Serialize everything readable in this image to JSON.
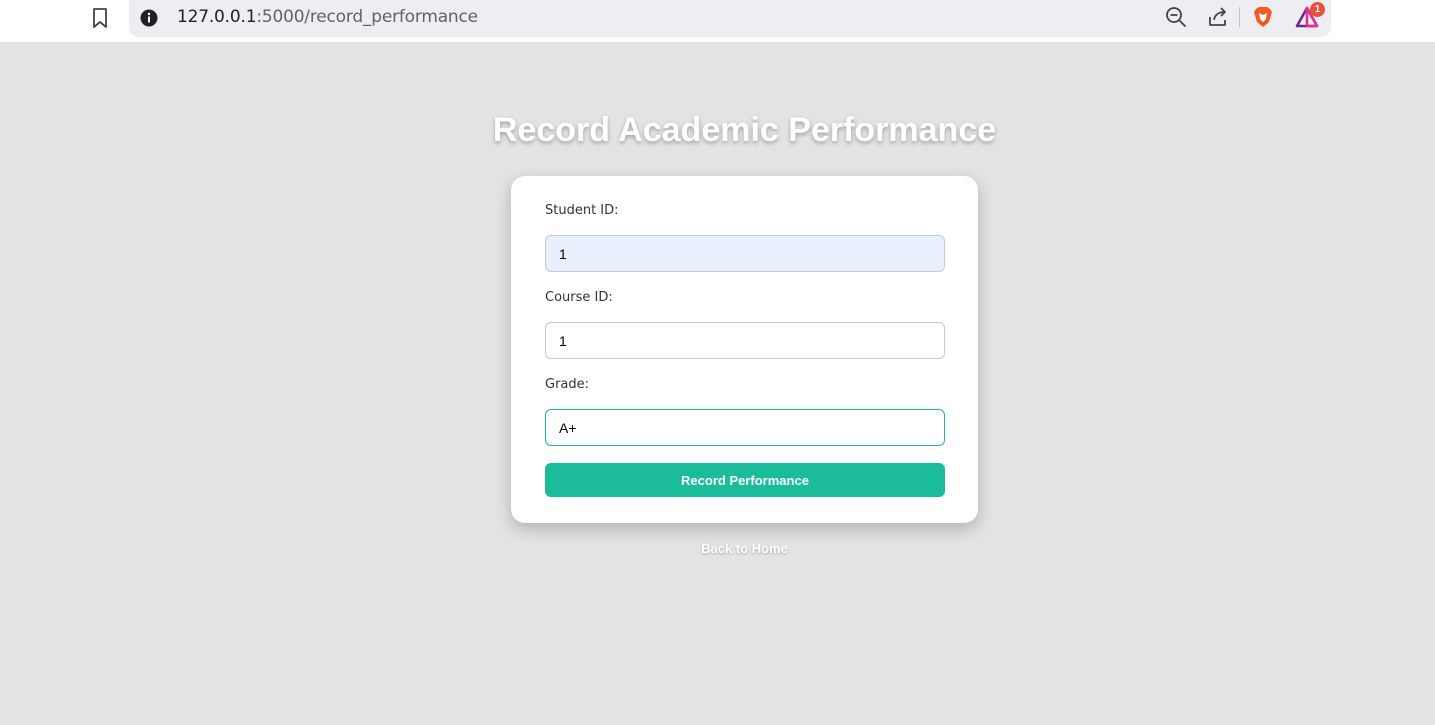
{
  "browser": {
    "url_host": "127.0.0.1",
    "url_rest": ":5000/record_performance",
    "rewards_badge_count": "1",
    "icons": [
      "bookmark-icon",
      "site-info-icon",
      "zoom-icon",
      "share-icon",
      "brave-icon",
      "rewards-icon"
    ]
  },
  "page": {
    "title": "Record Academic Performance",
    "back_link": "Back to Home",
    "background_color": "#e3e3e3",
    "accent_color": "#1abc9c"
  },
  "form": {
    "student_id": {
      "label": "Student ID:",
      "value": "1"
    },
    "course_id": {
      "label": "Course ID:",
      "value": "1"
    },
    "grade": {
      "label": "Grade:",
      "value": "A+"
    },
    "submit_label": "Record Performance"
  }
}
